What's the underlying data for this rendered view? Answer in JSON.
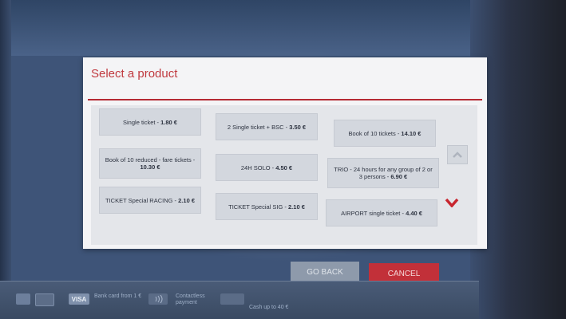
{
  "dialog": {
    "title": "Select a product"
  },
  "products": [
    {
      "label": "Single ticket - ",
      "price": "1.80 €"
    },
    {
      "label": "2 Single ticket + BSC - ",
      "price": "3.50 €"
    },
    {
      "label": "Book of 10 tickets - ",
      "price": "14.10 €"
    },
    {
      "label": "Book of 10 reduced - fare tickets - ",
      "price": "10.30 €"
    },
    {
      "label": "24H SOLO - ",
      "price": "4.50 €"
    },
    {
      "label": "TRIO - 24 hours for any group of 2 or 3 persons - ",
      "price": "6.90 €"
    },
    {
      "label": "TICKET Special RACING - ",
      "price": "2.10 €"
    },
    {
      "label": "TICKET Special SIG - ",
      "price": "2.10 €"
    },
    {
      "label": "AIRPORT single ticket - ",
      "price": "4.40 €"
    }
  ],
  "scroll": {
    "up_icon": "chevron-up-icon",
    "down_icon": "chevron-down-icon",
    "down_color": "#c8262f"
  },
  "buttons": {
    "back": "GO BACK",
    "cancel": "CANCEL"
  },
  "footer": {
    "visa": "VISA",
    "bank_card": "Bank card from 1 €",
    "contactless": "Contactless payment",
    "cash": "Cash up to 40 €"
  },
  "colors": {
    "accent": "#c0393f",
    "cancel": "#c23039",
    "back": "#8e9aab"
  }
}
